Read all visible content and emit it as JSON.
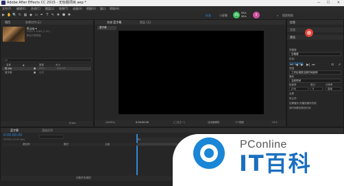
{
  "window": {
    "title": "Adobe After Effects CC 2015 - 无标题项目.aep *",
    "min": "—",
    "max": "☐",
    "close": "✕"
  },
  "menu": [
    "文件(F)",
    "编辑(E)",
    "合成(C)",
    "图层(L)",
    "效果(T)",
    "动画(A)",
    "视图(V)",
    "窗口",
    "帮助(H)"
  ],
  "toolbar": {
    "tools": [
      "▶",
      "✋",
      "🔍",
      "↻",
      "▦",
      "◆",
      "▭",
      "✒",
      "T",
      "✎",
      "✚",
      "⬣",
      "✱"
    ],
    "workspace_default": "标准",
    "workspace_alt": "小屏幕",
    "search_label": "搜索帮助",
    "badge_green": "3%",
    "badge_green_up": "0K/s",
    "badge_green_down": "0K/s",
    "badge_pink": "0"
  },
  "project_panel": {
    "tab_project": "项目",
    "tab_effects": "效果控件(无)",
    "file_name": "纸.jpg ▾",
    "file_info": "1920 x 1080 (1.00)",
    "file_info2": "数百万种颜色",
    "search_placeholder": "ρ▾",
    "columns": [
      "名称",
      "▲",
      "类型",
      "大小"
    ],
    "items": [
      {
        "name": "纸.jpg",
        "type": "JPEG",
        "size": "446 KB"
      },
      {
        "name": "蓝字幕",
        "type": "合成",
        "size": ""
      }
    ],
    "footer": "8 bpc"
  },
  "composition_panel": {
    "tab_label": "合成 蓝字幕",
    "tab_layer": "图层 (无)",
    "breadcrumb": "蓝字幕",
    "zoom": "(46.8%)",
    "timecode": "0:00:00:00",
    "resolution": "(二分之一)",
    "camera": "活动摄像机",
    "view": "1个视图",
    "exposure": "+0.0"
  },
  "right_panel": {
    "tab_info": "信息",
    "tab_audio": "音频",
    "preview_label": "预览",
    "shortcut_label": "快捷键",
    "shortcut_value": "空格键",
    "include_label": "包含:",
    "cache_label": "在回放前缓存",
    "range_label": "范围",
    "range_value": "工作区域按当前时间延伸",
    "play_from_label": "播放",
    "play_from_value": "当前时间",
    "frame_rate_label": "帧速率",
    "skip_label": "跳过",
    "res_label": "分辨率",
    "frame_rate_value": "(25)",
    "skip_value": "0",
    "res_value": "自动",
    "fullscreen_label": "全屏",
    "stop_label": "停止时:",
    "cache_option": "如果缓存,则播放缓存的帧",
    "move_time_option": "将时间移到预览时间"
  },
  "timeline": {
    "tab_comp": "蓝字幕",
    "tab_render": "渲染队列",
    "timecode": "0:00:00:00",
    "timecode_sub": "00000 (25.00 fps)",
    "layer_name_header": "源名称",
    "mode_header": "模式",
    "parent_header": "父级",
    "ruler_start": "0s",
    "footer": "切换开关/模式"
  },
  "watermark": {
    "brand": "PConline",
    "name": "IT百科"
  },
  "colors": {
    "accent_blue": "#2e8ad8",
    "record_red": "#e0443a",
    "brand_blue": "#1a86d6"
  }
}
